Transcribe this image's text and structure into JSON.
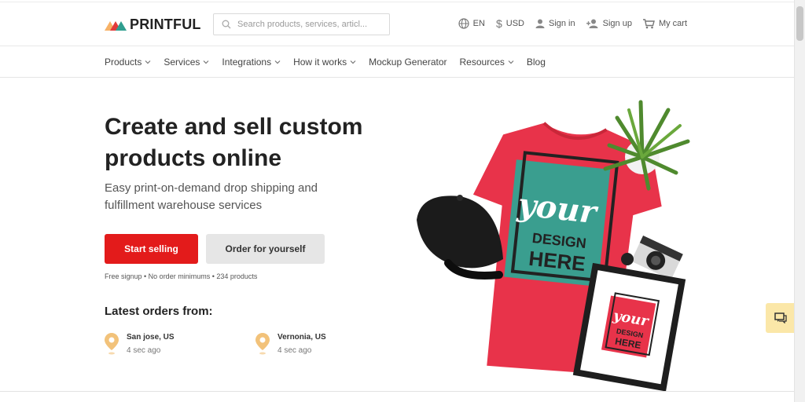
{
  "brand": {
    "name": "PRINTFUL",
    "colors": [
      "#f7b267",
      "#e23a3a",
      "#2f9e8f"
    ]
  },
  "search": {
    "placeholder": "Search products, services, articl..."
  },
  "utilities": {
    "language": "EN",
    "currency": "USD",
    "sign_in": "Sign in",
    "sign_up": "Sign up",
    "cart": "My cart"
  },
  "nav": {
    "items": [
      {
        "label": "Products",
        "dropdown": true
      },
      {
        "label": "Services",
        "dropdown": true
      },
      {
        "label": "Integrations",
        "dropdown": true
      },
      {
        "label": "How it works",
        "dropdown": true
      },
      {
        "label": "Mockup Generator",
        "dropdown": false
      },
      {
        "label": "Resources",
        "dropdown": true
      },
      {
        "label": "Blog",
        "dropdown": false
      }
    ]
  },
  "hero": {
    "title": "Create and sell custom products online",
    "subtitle": "Easy print-on-demand drop shipping and fulfillment warehouse services",
    "primary_button": "Start selling",
    "secondary_button": "Order for yourself",
    "tagline": "Free signup • No order minimums • 234 products",
    "art": {
      "tshirt_text_1": "your",
      "tshirt_text_2": "DESIGN",
      "tshirt_text_3": "HERE",
      "frame_text_1": "your",
      "frame_text_2": "DESIGN",
      "frame_text_3": "HERE"
    }
  },
  "latest_orders": {
    "heading": "Latest orders from:",
    "orders": [
      {
        "location": "San jose, US",
        "time": "4 sec ago"
      },
      {
        "location": "Vernonia, US",
        "time": "4 sec ago"
      }
    ]
  },
  "accent": {
    "primary": "#e31b1b",
    "chat": "#fbe7a8",
    "pin": "#f2c27a"
  }
}
